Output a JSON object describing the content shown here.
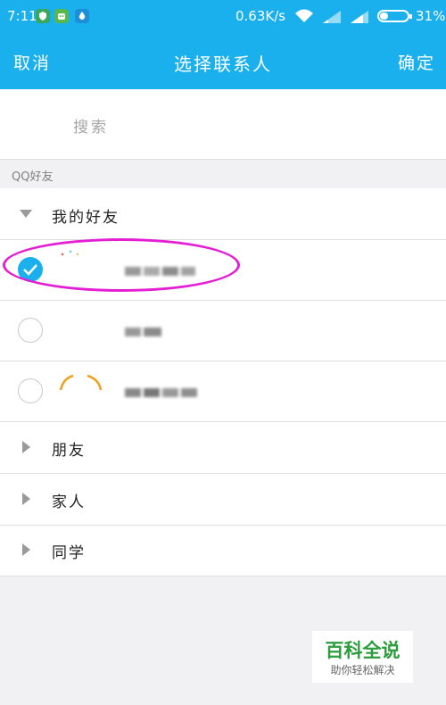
{
  "status_bar": {
    "time": "7:11",
    "net_speed": "0.63K/s",
    "battery": "31%",
    "app_icons": [
      "shield-app-icon",
      "android-app-icon",
      "droplet-app-icon"
    ]
  },
  "nav": {
    "cancel": "取消",
    "title": "选择联系人",
    "confirm": "确定"
  },
  "search": {
    "placeholder": "搜索"
  },
  "section": {
    "title": "QQ好友"
  },
  "groups": [
    {
      "label": "我的好友",
      "expanded": true
    },
    {
      "label": "朋友",
      "expanded": false
    },
    {
      "label": "家人",
      "expanded": false
    },
    {
      "label": "同学",
      "expanded": false
    }
  ],
  "contacts": [
    {
      "name_obscured": true,
      "selected": true
    },
    {
      "name_obscured": true,
      "selected": false
    },
    {
      "name_obscured": true,
      "selected": false
    }
  ],
  "watermark": {
    "title": "百科全说",
    "subtitle": "助你轻松解决"
  },
  "colors": {
    "accent": "#1ab0ee",
    "highlight": "#e41fd3",
    "watermark_green": "#2a9d3c"
  }
}
